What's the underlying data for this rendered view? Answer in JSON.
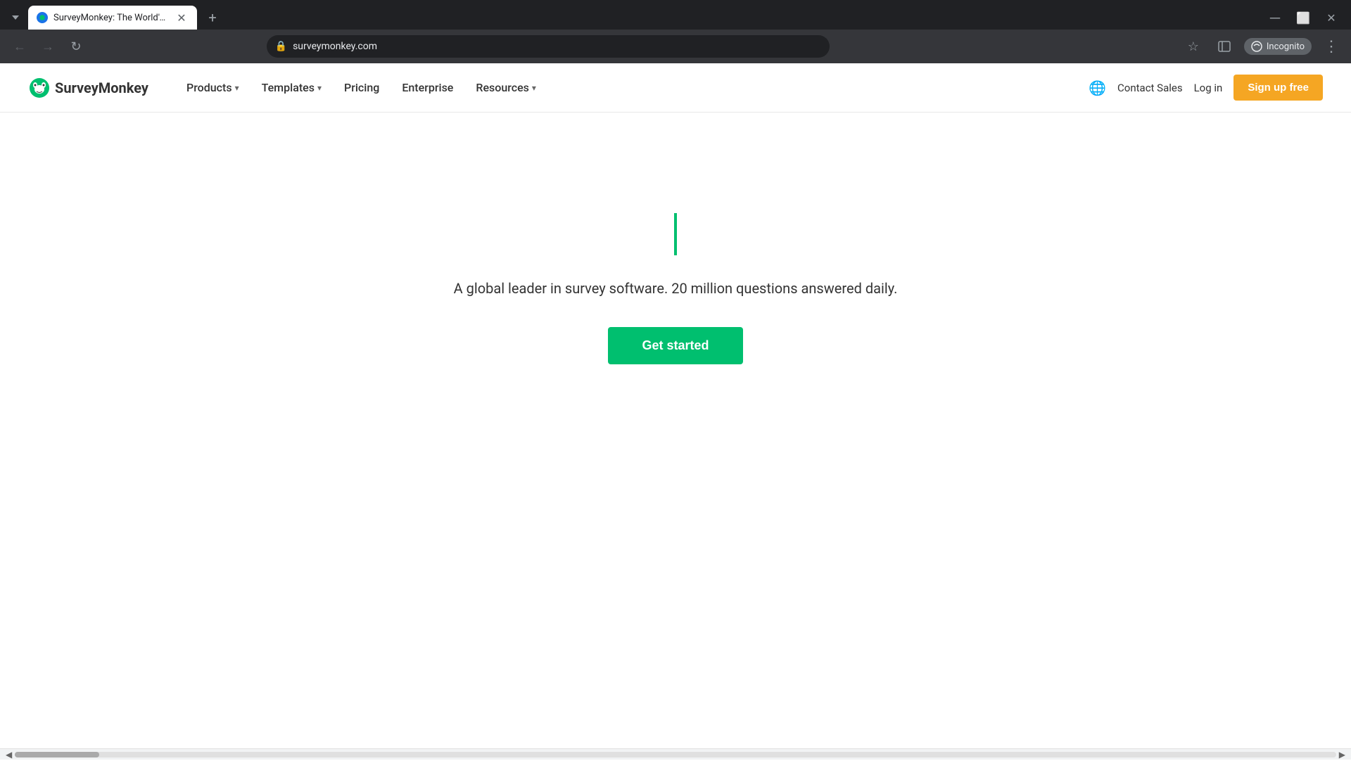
{
  "browser": {
    "tab": {
      "title": "SurveyMonkey: The World's M...",
      "favicon_color": "#00bf6f",
      "url": "surveymonkey.com"
    },
    "new_tab_label": "+",
    "nav": {
      "back_disabled": true,
      "forward_disabled": true
    },
    "incognito_label": "Incognito",
    "menu_icon": "⋮"
  },
  "navbar": {
    "logo_text": "SurveyMonkey",
    "nav_items": [
      {
        "label": "Products",
        "has_dropdown": true
      },
      {
        "label": "Templates",
        "has_dropdown": true
      },
      {
        "label": "Pricing",
        "has_dropdown": false
      },
      {
        "label": "Enterprise",
        "has_dropdown": false
      },
      {
        "label": "Resources",
        "has_dropdown": true
      }
    ],
    "contact_sales": "Contact Sales",
    "login": "Log in",
    "signup": "Sign up free"
  },
  "hero": {
    "subtitle": "A global leader in survey software. 20 million questions answered daily.",
    "cta_button": "Get started"
  }
}
